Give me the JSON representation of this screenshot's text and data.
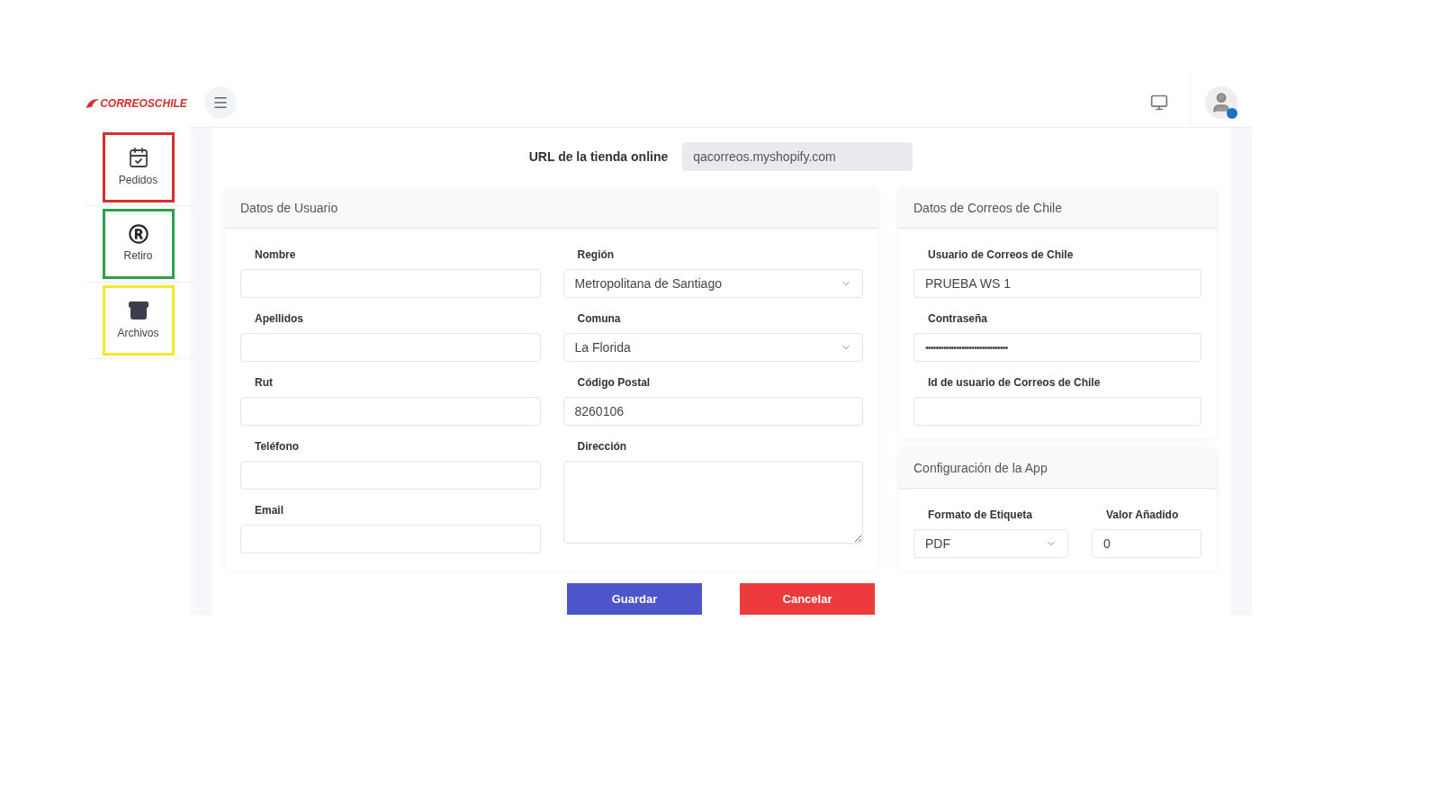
{
  "logo": {
    "text": "CORREOSCHILE"
  },
  "sidebar": {
    "items": [
      {
        "label": "Pedidos",
        "color": "#d32f2f"
      },
      {
        "label": "Retiro",
        "color": "#2e9e4f"
      },
      {
        "label": "Archivos",
        "color": "#f2e92c"
      }
    ]
  },
  "store_url": {
    "label": "URL de la tienda online",
    "value": "qacorreos.myshopify.com"
  },
  "user_card": {
    "title": "Datos de Usuario",
    "columns": [
      [
        {
          "label": "Nombre",
          "kind": "text"
        },
        {
          "label": "Apellidos",
          "kind": "text"
        },
        {
          "label": "Rut",
          "kind": "text"
        },
        {
          "label": "Teléfono",
          "kind": "text"
        },
        {
          "label": "Email",
          "kind": "text"
        }
      ],
      [
        {
          "label": "Región",
          "kind": "select",
          "value": "Metropolitana de Santiago"
        },
        {
          "label": "Comuna",
          "kind": "select",
          "value": "La Florida"
        },
        {
          "label": "Código Postal",
          "kind": "text",
          "value": "8260106"
        },
        {
          "label": "Dirección",
          "kind": "textarea"
        }
      ]
    ]
  },
  "correos_card": {
    "title": "Datos de Correos de Chile",
    "fields": [
      {
        "label": "Usuario de Correos de Chile",
        "kind": "text",
        "value": "PRUEBA WS 1"
      },
      {
        "label": "Contraseña",
        "kind": "password",
        "value": "••••••••••••••••••••••••••••••••"
      },
      {
        "label": "Id de usuario de Correos de Chile",
        "kind": "text"
      }
    ]
  },
  "app_card": {
    "title": "Configuración de la App",
    "fields": [
      {
        "label": "Formato de Etiqueta",
        "kind": "select",
        "value": "PDF"
      },
      {
        "label": "Valor Añadido",
        "kind": "text",
        "value": "0"
      }
    ]
  },
  "buttons": [
    {
      "label": "Guardar",
      "kind": "primary"
    },
    {
      "label": "Cancelar",
      "kind": "danger"
    }
  ]
}
